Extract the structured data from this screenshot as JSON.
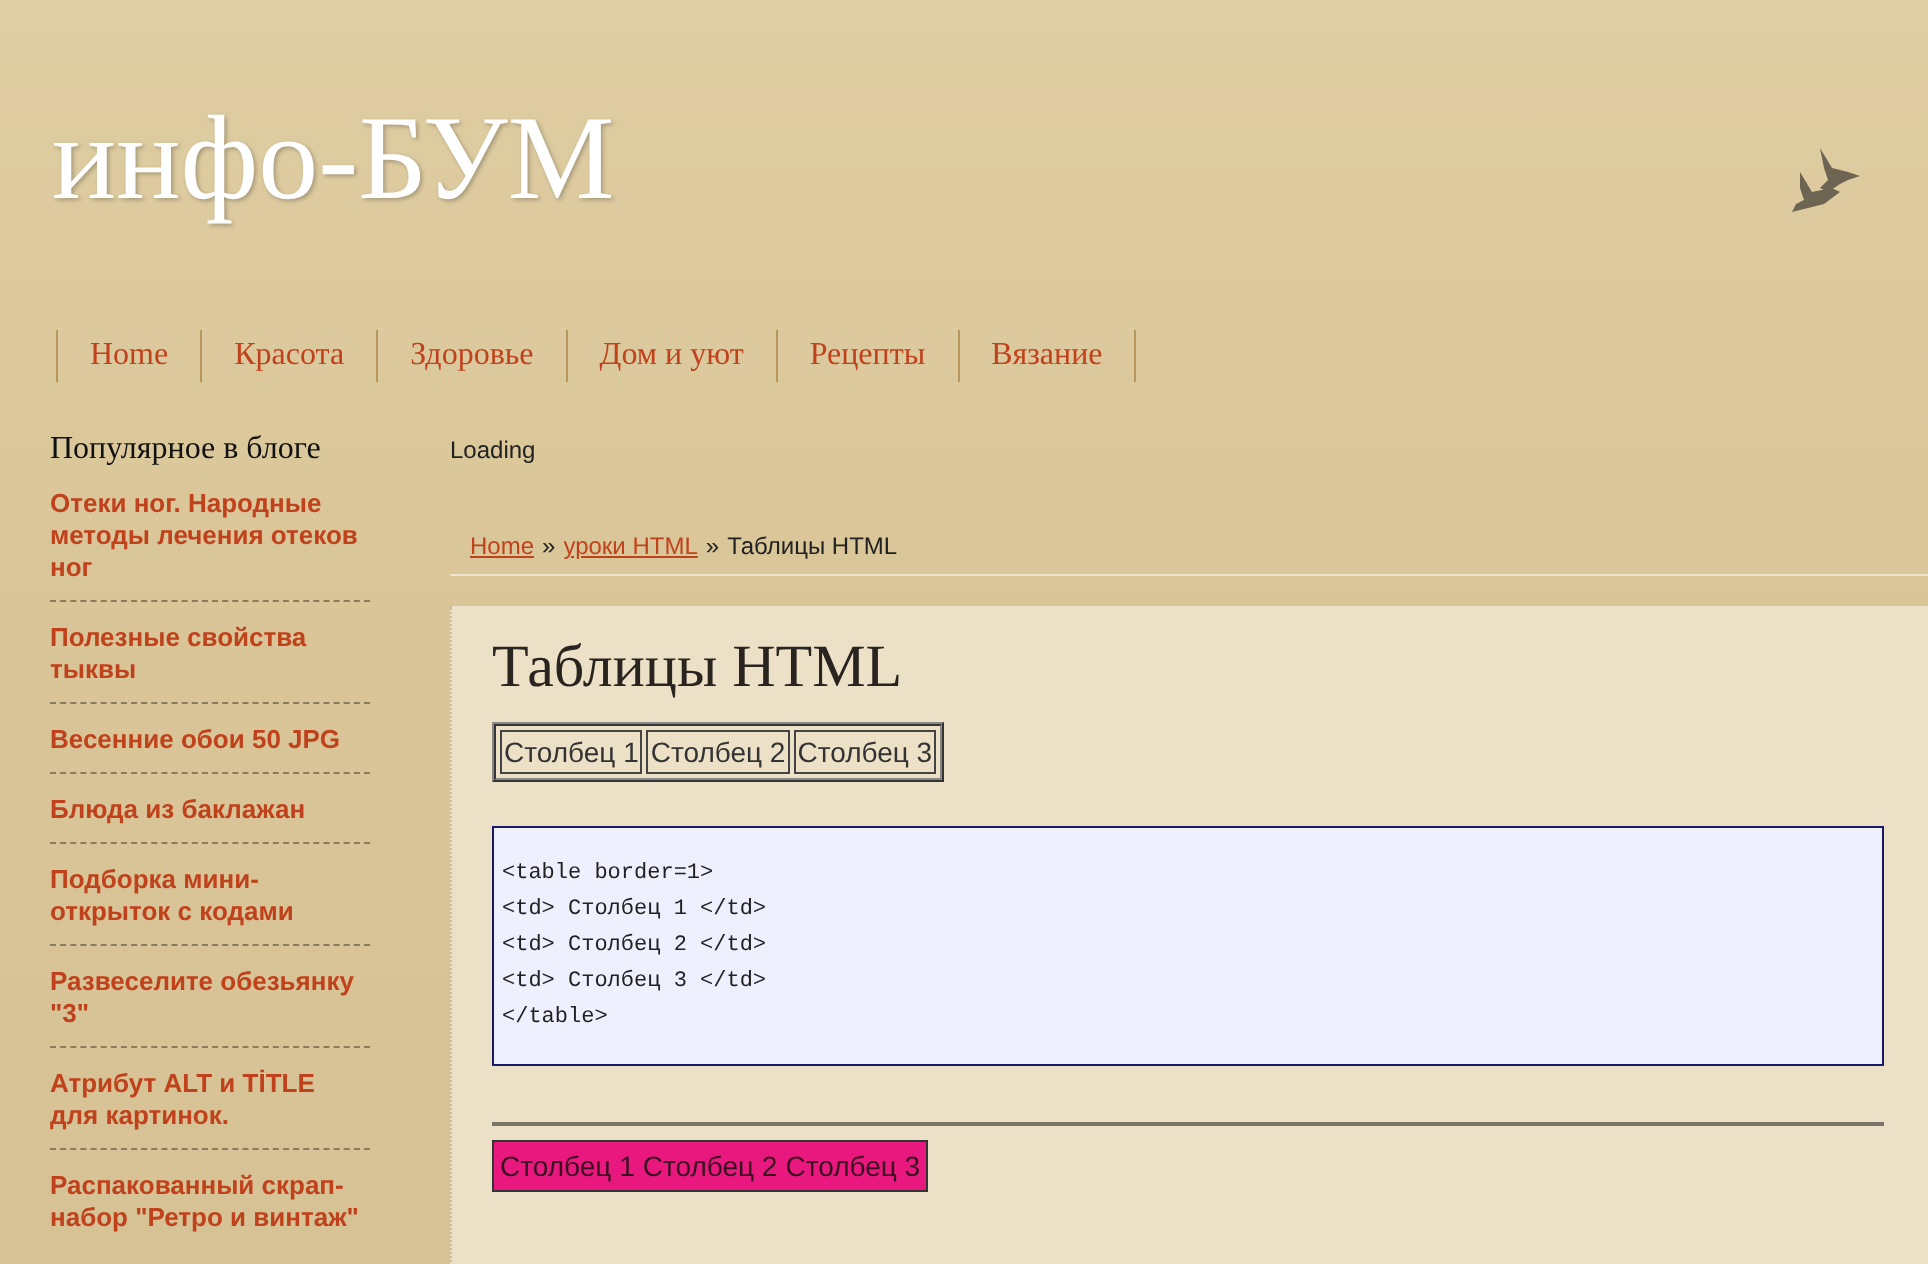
{
  "site_title": "инфо-БУМ",
  "nav": [
    "Home",
    "Красота",
    "Здоровье",
    "Дом и уют",
    "Рецепты",
    "Вязание"
  ],
  "sidebar": {
    "title": "Популярное в блоге",
    "items": [
      "Отеки ног. Народные методы лечения отеков ног",
      "Полезные свойства тыквы",
      "Весенние обои 50 JPG",
      "Блюда из баклажан",
      "Подборка мини-открыток с кодами",
      "Развеселите обезьянку \"3\"",
      "Атрибут ALT и TİTLE для картинок.",
      "Распакованный скрап-набор \"Ретро и винтаж\""
    ]
  },
  "loading": "Loading",
  "breadcrumb": {
    "links": [
      "Home",
      "уроки HTML"
    ],
    "separator": "»",
    "current": "Таблицы HTML"
  },
  "article": {
    "title": "Таблицы HTML",
    "tables": [
      {
        "kind": "plain",
        "cells": [
          "Столбец 1",
          "Столбец 2",
          "Столбец 3"
        ]
      }
    ],
    "code": [
      "<table border=1>",
      "<td> Столбец 1 </td>",
      "<td> Столбец 2 </td>",
      "<td> Столбец 3 </td>",
      "</table>"
    ],
    "tables_after_rule": [
      {
        "kind": "highlighted",
        "cells": [
          "Столбец 1",
          "Столбец 2",
          "Столбец 3"
        ]
      }
    ]
  }
}
